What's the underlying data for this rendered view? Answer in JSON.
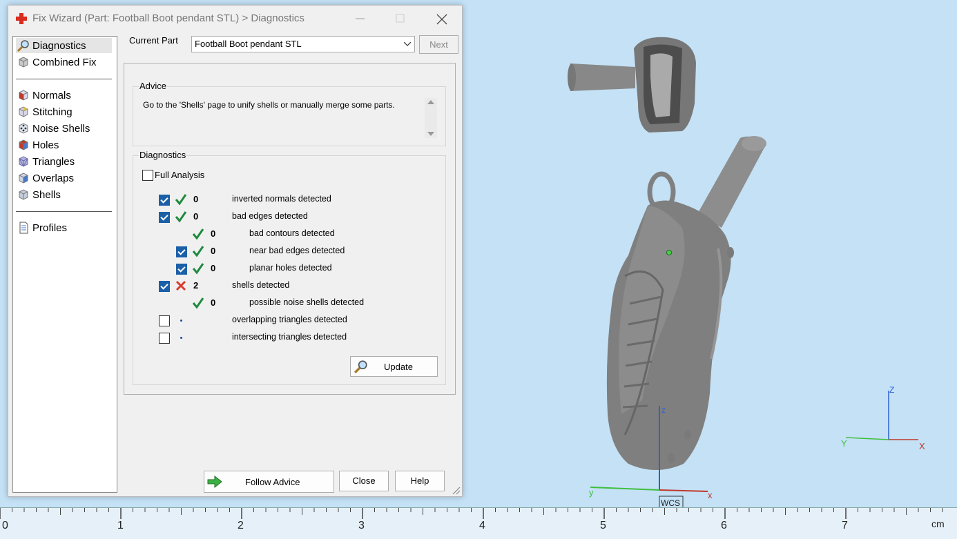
{
  "window": {
    "title": "Fix Wizard (Part: Football Boot pendant STL) > Diagnostics"
  },
  "nav": {
    "items": [
      {
        "label": "Diagnostics",
        "icon": "magnifier-icon"
      },
      {
        "label": "Combined Fix",
        "icon": "cube-icon"
      },
      {
        "label": "Normals",
        "icon": "cube-icon"
      },
      {
        "label": "Stitching",
        "icon": "cube-icon"
      },
      {
        "label": "Noise Shells",
        "icon": "dice-icon"
      },
      {
        "label": "Holes",
        "icon": "cube-icon"
      },
      {
        "label": "Triangles",
        "icon": "cube-icon"
      },
      {
        "label": "Overlaps",
        "icon": "cube-icon"
      },
      {
        "label": "Shells",
        "icon": "cube-icon"
      },
      {
        "label": "Profiles",
        "icon": "document-icon"
      }
    ]
  },
  "header": {
    "current_part_label": "Current Part",
    "current_part_value": "Football Boot pendant STL",
    "next_label": "Next"
  },
  "advice": {
    "title": "Advice",
    "text": "Go to the 'Shells' page to unify shells or manually merge some parts."
  },
  "diagnostics": {
    "title": "Diagnostics",
    "full_analysis_label": "Full Analysis",
    "full_analysis_checked": false,
    "rows": [
      {
        "checked": true,
        "status": "ok",
        "value": "0",
        "text": "inverted normals detected",
        "indent": 0,
        "has_checkbox": true
      },
      {
        "checked": true,
        "status": "ok",
        "value": "0",
        "text": "bad edges detected",
        "indent": 0,
        "has_checkbox": true
      },
      {
        "checked": false,
        "status": "ok",
        "value": "0",
        "text": "bad contours detected",
        "indent": 1,
        "has_checkbox": false
      },
      {
        "checked": true,
        "status": "ok",
        "value": "0",
        "text": "near bad edges detected",
        "indent": 1,
        "has_checkbox": true
      },
      {
        "checked": true,
        "status": "ok",
        "value": "0",
        "text": "planar holes detected",
        "indent": 1,
        "has_checkbox": true
      },
      {
        "checked": true,
        "status": "error",
        "value": "2",
        "text": "shells detected",
        "indent": 0,
        "has_checkbox": true
      },
      {
        "checked": false,
        "status": "ok",
        "value": "0",
        "text": "possible noise shells detected",
        "indent": 1,
        "has_checkbox": false
      },
      {
        "checked": false,
        "status": "pending",
        "value": "",
        "text": "overlapping triangles detected",
        "indent": 0,
        "has_checkbox": true
      },
      {
        "checked": false,
        "status": "pending",
        "value": "",
        "text": "intersecting triangles detected",
        "indent": 0,
        "has_checkbox": true
      }
    ],
    "update_label": "Update"
  },
  "footer": {
    "follow_advice_label": "Follow Advice",
    "close_label": "Close",
    "help_label": "Help"
  },
  "viewport": {
    "axis_labels": {
      "z": "z",
      "y": "y",
      "x": "x",
      "wcs": "WCS"
    },
    "mini_axis_labels": {
      "z": "Z",
      "y": "Y",
      "x": "X"
    }
  },
  "ruler": {
    "labels": [
      "0",
      "1",
      "2",
      "3",
      "4",
      "5",
      "6",
      "7"
    ],
    "unit": "cm"
  },
  "colors": {
    "viewport_bg": "#c4e1f6",
    "check_ok": "#1e8a3e",
    "check_error": "#d93a2b",
    "checkbox_on": "#1a5fa8",
    "axis_x": "#c0392b",
    "axis_y": "#3fbf3f",
    "axis_z": "#2f5fd0"
  }
}
